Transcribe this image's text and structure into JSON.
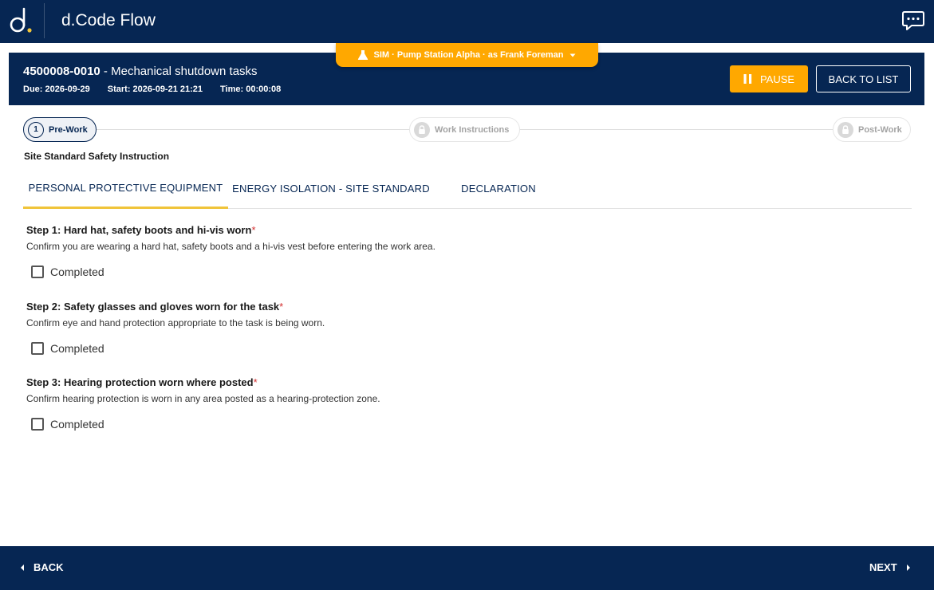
{
  "app": {
    "title": "d.Code Flow",
    "logo_icon": "dcode-logo-icon",
    "chat_icon": "chat-icon"
  },
  "sim_banner": {
    "label": "SIM · Pump Station Alpha · as Frank Foreman",
    "icon": "flask-icon",
    "dropdown_icon": "caret-down-icon",
    "color": "#ffa800"
  },
  "task": {
    "code": "4500008-0010",
    "separator": " - ",
    "name": "Mechanical shutdown tasks",
    "due": "Due: 2026-09-29",
    "start": "Start: 2026-09-21 21:21",
    "time": "Time: 00:00:08"
  },
  "actions": {
    "pause_label": "PAUSE",
    "back_to_list_label": "BACK TO LIST"
  },
  "stages": [
    {
      "number": "1",
      "label": "Pre-Work",
      "state": "active"
    },
    {
      "label": "Work Instructions",
      "state": "locked"
    },
    {
      "label": "Post-Work",
      "state": "locked"
    }
  ],
  "section_title": "Site Standard Safety Instruction",
  "tabs": [
    {
      "label": "PERSONAL PROTECTIVE EQUIPMENT",
      "active": true
    },
    {
      "label": "ENERGY ISOLATION - SITE STANDARD",
      "active": false
    },
    {
      "label": "DECLARATION",
      "active": false
    }
  ],
  "steps": [
    {
      "title": "Step 1: Hard hat, safety boots and hi-vis worn",
      "required_mark": "*",
      "description": "Confirm you are wearing a hard hat, safety boots and a hi-vis vest before entering the work area.",
      "checkbox_label": "Completed",
      "checked": false
    },
    {
      "title": "Step 2: Safety glasses and gloves worn for the task",
      "required_mark": "*",
      "description": "Confirm eye and hand protection appropriate to the task is being worn.",
      "checkbox_label": "Completed",
      "checked": false
    },
    {
      "title": "Step 3: Hearing protection worn where posted",
      "required_mark": "*",
      "description": "Confirm hearing protection is worn in any area posted as a hearing-protection zone.",
      "checkbox_label": "Completed",
      "checked": false
    }
  ],
  "footer": {
    "back_label": "BACK",
    "next_label": "NEXT"
  },
  "colors": {
    "navy": "#062653",
    "accent": "#ffa800",
    "tab_underline": "#f0c43a",
    "required": "#d32f2f"
  }
}
